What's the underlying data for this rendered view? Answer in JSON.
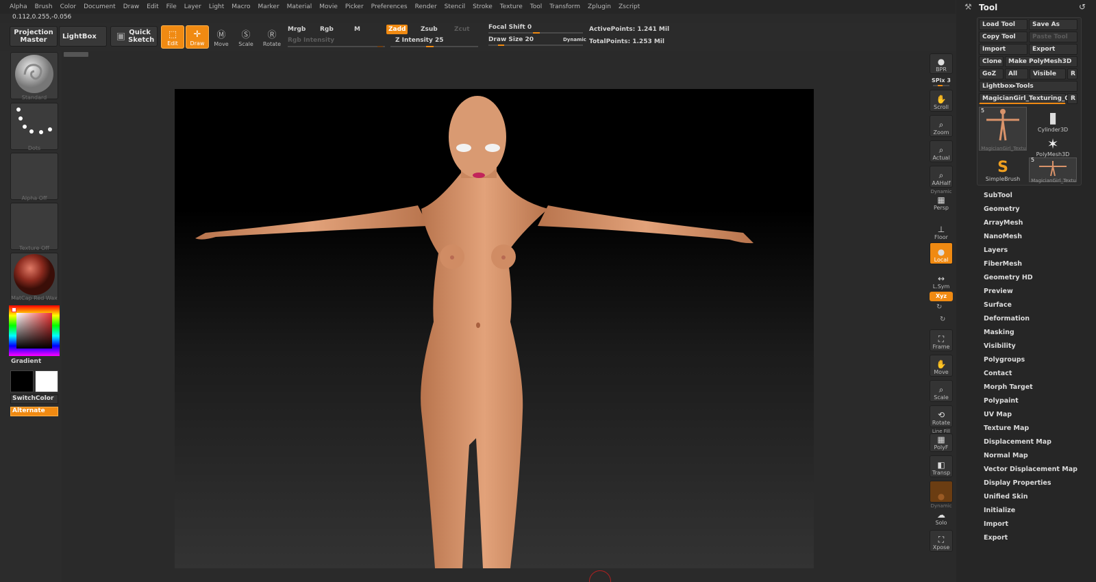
{
  "menu": [
    "Alpha",
    "Brush",
    "Color",
    "Document",
    "Draw",
    "Edit",
    "File",
    "Layer",
    "Light",
    "Macro",
    "Marker",
    "Material",
    "Movie",
    "Picker",
    "Preferences",
    "Render",
    "Stencil",
    "Stroke",
    "Texture",
    "Tool",
    "Transform",
    "Zplugin",
    "Zscript"
  ],
  "coords": "0.112,0.255,-0.056",
  "toolbar": {
    "projection_master": "Projection Master",
    "lightbox": "LightBox",
    "quick_sketch": "Quick Sketch",
    "edit": "Edit",
    "draw": "Draw",
    "move": "Move",
    "scale": "Scale",
    "rotate": "Rotate",
    "mrgb": "Mrgb",
    "rgb": "Rgb",
    "m": "M",
    "rgb_intensity": "Rgb Intensity",
    "zadd": "Zadd",
    "zsub": "Zsub",
    "zcut": "Zcut",
    "z_intensity": "Z Intensity 25",
    "focal_shift": "Focal Shift 0",
    "draw_size": "Draw Size 20",
    "dynamic": "Dynamic",
    "active_points": "ActivePoints: 1.241 Mil",
    "total_points": "TotalPoints: 1.253 Mil"
  },
  "left": {
    "brush": "Standard",
    "stroke": "Dots",
    "alpha": "Alpha Off",
    "texture": "Texture Off",
    "material": "MatCap Red Wax",
    "gradient": "Gradient",
    "switchcolor": "SwitchColor",
    "alternate": "Alternate"
  },
  "right_shelf": {
    "bpr": "BPR",
    "spix": "SPix 3",
    "scroll": "Scroll",
    "zoom": "Zoom",
    "actual": "Actual",
    "aahalf": "AAHalf",
    "dynamic": "Dynamic",
    "persp": "Persp",
    "floor": "Floor",
    "local": "Local",
    "lsym": "L.Sym",
    "xyz": "Xyz",
    "frame": "Frame",
    "move": "Move",
    "scale": "Scale",
    "rotate": "Rotate",
    "linefill": "Line Fill",
    "polyf": "PolyF",
    "transp": "Transp",
    "dynamic2": "Dynamic",
    "solo": "Solo",
    "xpose": "Xpose"
  },
  "tool": {
    "title": "Tool",
    "load_tool": "Load Tool",
    "save_as": "Save As",
    "copy_tool": "Copy Tool",
    "paste_tool": "Paste Tool",
    "import": "Import",
    "export": "Export",
    "clone": "Clone",
    "make_polymesh": "Make PolyMesh3D",
    "goz": "GoZ",
    "all": "All",
    "visible": "Visible",
    "r": "R",
    "lightbox_tools": "Lightbox▸Tools",
    "current_tool": "MagicianGirl_Texturing_0",
    "thumbs": [
      {
        "label": "MagicianGirl_Textu",
        "badge": "5"
      },
      {
        "label": "Cylinder3D",
        "badge": ""
      },
      {
        "label": "PolyMesh3D",
        "badge": ""
      },
      {
        "label": "SimpleBrush",
        "badge": ""
      },
      {
        "label": "MagicianGirl_Textu",
        "badge": "5"
      }
    ],
    "items": [
      "SubTool",
      "Geometry",
      "ArrayMesh",
      "NanoMesh",
      "Layers",
      "FiberMesh",
      "Geometry HD",
      "Preview",
      "Surface",
      "Deformation",
      "Masking",
      "Visibility",
      "Polygroups",
      "Contact",
      "Morph Target",
      "Polypaint",
      "UV Map",
      "Texture Map",
      "Displacement Map",
      "Normal Map",
      "Vector Displacement Map",
      "Display Properties",
      "Unified Skin",
      "Initialize",
      "Import",
      "Export"
    ]
  },
  "colors": {
    "accent": "#f08a12",
    "panel": "#262626",
    "skin": "#d99a72"
  }
}
